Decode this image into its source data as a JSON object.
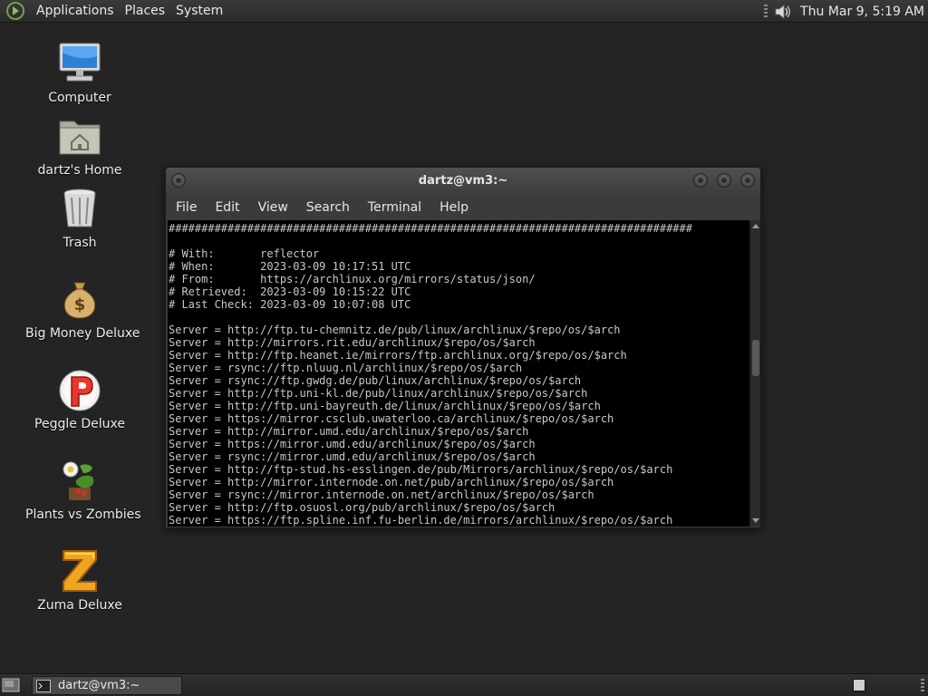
{
  "top_panel": {
    "menus": [
      "Applications",
      "Places",
      "System"
    ],
    "clock": "Thu Mar  9,  5:19 AM"
  },
  "desktop": {
    "icons": [
      {
        "label": "Computer",
        "icon": "computer-icon"
      },
      {
        "label": "dartz's Home",
        "icon": "home-folder-icon"
      },
      {
        "label": "Trash",
        "icon": "trash-icon"
      },
      {
        "label": "Big Money Deluxe",
        "icon": "money-bag-icon"
      },
      {
        "label": "Peggle Deluxe",
        "icon": "peggle-icon"
      },
      {
        "label": "Plants vs Zombies",
        "icon": "plants-vs-zombies-icon"
      },
      {
        "label": "Zuma Deluxe",
        "icon": "zuma-icon"
      }
    ]
  },
  "terminal": {
    "title": "dartz@vm3:~",
    "menu": [
      "File",
      "Edit",
      "View",
      "Search",
      "Terminal",
      "Help"
    ],
    "lines": [
      "################################################################################",
      "",
      "# With:       reflector",
      "# When:       2023-03-09 10:17:51 UTC",
      "# From:       https://archlinux.org/mirrors/status/json/",
      "# Retrieved:  2023-03-09 10:15:22 UTC",
      "# Last Check: 2023-03-09 10:07:08 UTC",
      "",
      "Server = http://ftp.tu-chemnitz.de/pub/linux/archlinux/$repo/os/$arch",
      "Server = http://mirrors.rit.edu/archlinux/$repo/os/$arch",
      "Server = http://ftp.heanet.ie/mirrors/ftp.archlinux.org/$repo/os/$arch",
      "Server = rsync://ftp.nluug.nl/archlinux/$repo/os/$arch",
      "Server = rsync://ftp.gwdg.de/pub/linux/archlinux/$repo/os/$arch",
      "Server = http://ftp.uni-kl.de/pub/linux/archlinux/$repo/os/$arch",
      "Server = http://ftp.uni-bayreuth.de/linux/archlinux/$repo/os/$arch",
      "Server = https://mirror.csclub.uwaterloo.ca/archlinux/$repo/os/$arch",
      "Server = http://mirror.umd.edu/archlinux/$repo/os/$arch",
      "Server = https://mirror.umd.edu/archlinux/$repo/os/$arch",
      "Server = rsync://mirror.umd.edu/archlinux/$repo/os/$arch",
      "Server = http://ftp-stud.hs-esslingen.de/pub/Mirrors/archlinux/$repo/os/$arch",
      "Server = http://mirror.internode.on.net/pub/archlinux/$repo/os/$arch",
      "Server = rsync://mirror.internode.on.net/archlinux/$repo/os/$arch",
      "Server = http://ftp.osuosl.org/pub/archlinux/$repo/os/$arch",
      "Server = https://ftp.spline.inf.fu-berlin.de/mirrors/archlinux/$repo/os/$arch"
    ]
  },
  "bottom_panel": {
    "task_label": "dartz@vm3:~"
  },
  "colors": {
    "desktop_bg": "#242424",
    "terminal_bg": "#000000",
    "terminal_fg": "#c8c8c8"
  }
}
